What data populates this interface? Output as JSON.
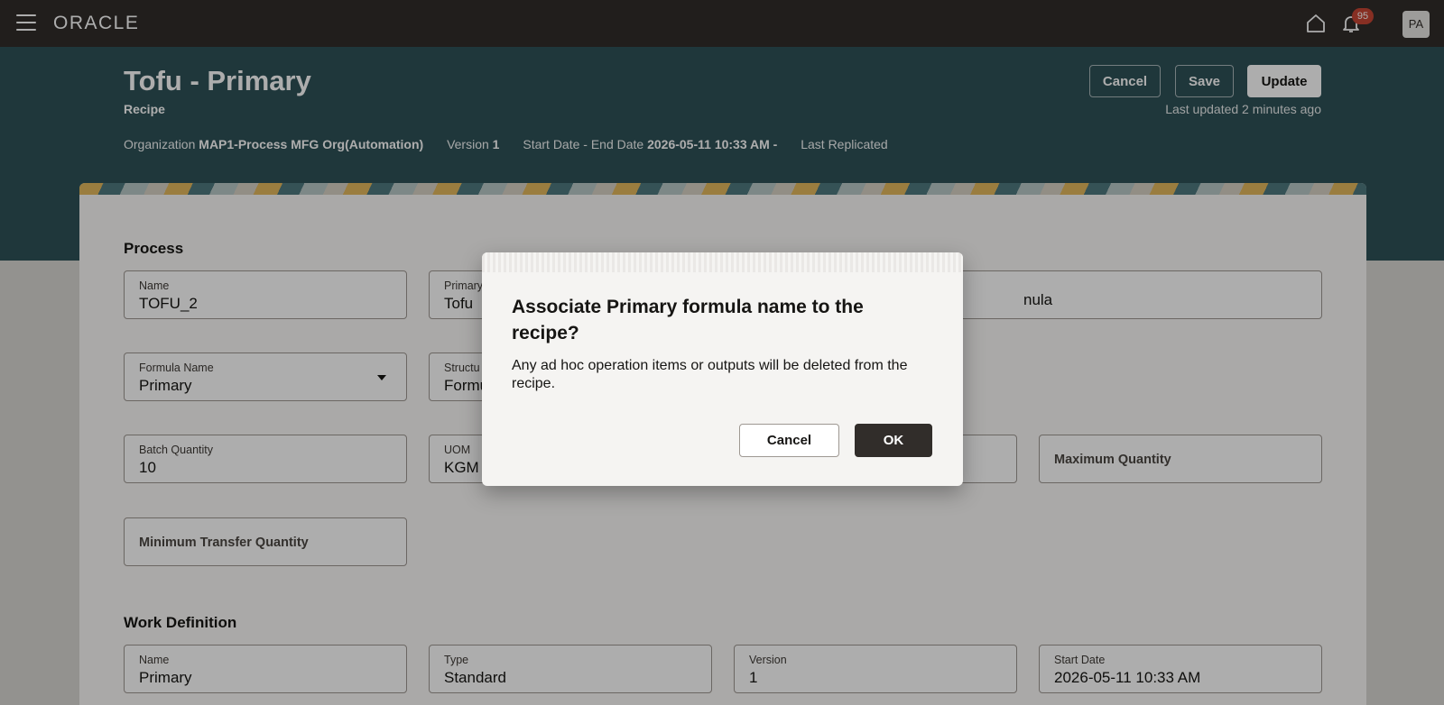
{
  "topbar": {
    "logo": "ORACLE",
    "notification_count": "95",
    "avatar_initials": "PA"
  },
  "header": {
    "title": "Tofu - Primary",
    "subtitle": "Recipe",
    "buttons": {
      "cancel": "Cancel",
      "save": "Save",
      "update": "Update"
    },
    "last_updated": "Last updated 2 minutes ago",
    "meta": {
      "org_label": "Organization",
      "org_value": "MAP1-Process MFG Org(Automation)",
      "version_label": "Version",
      "version_value": "1",
      "dates_label": "Start Date - End Date",
      "dates_value": "2026-05-11 10:33 AM -",
      "replicated_label": "Last Replicated"
    }
  },
  "process": {
    "title": "Process",
    "name": {
      "label": "Name",
      "value": "TOFU_2"
    },
    "primary": {
      "label": "Primary",
      "value": "Tofu"
    },
    "third_field_value": "nula",
    "formula_name": {
      "label": "Formula Name",
      "value": "Primary"
    },
    "structure": {
      "label": "Structu",
      "value": "Formu"
    },
    "batch_quantity": {
      "label": "Batch Quantity",
      "value": "10"
    },
    "uom": {
      "label": "UOM",
      "value": "KGM"
    },
    "maximum_quantity": {
      "placeholder": "Maximum Quantity"
    },
    "min_transfer": {
      "placeholder": "Minimum Transfer Quantity"
    }
  },
  "work_definition": {
    "title": "Work Definition",
    "name": {
      "label": "Name",
      "value": "Primary"
    },
    "type": {
      "label": "Type",
      "value": "Standard"
    },
    "version": {
      "label": "Version",
      "value": "1"
    },
    "start_date": {
      "label": "Start Date",
      "value": "2026-05-11 10:33 AM"
    }
  },
  "dialog": {
    "title": "Associate Primary formula name to the recipe?",
    "message": "Any ad hoc operation items or outputs will be deleted from the recipe.",
    "cancel_label": "Cancel",
    "ok_label": "OK"
  },
  "colors": {
    "topbar": "#312d2a",
    "header": "#2e5157",
    "badge": "#c74634"
  }
}
